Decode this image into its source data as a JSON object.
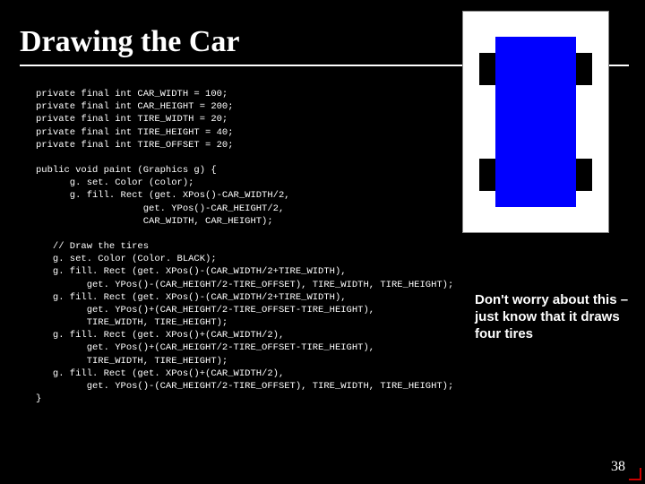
{
  "title": "Drawing the Car",
  "code": {
    "decl_1": "private final int CAR_WIDTH = 100;",
    "decl_2": "private final int CAR_HEIGHT = 200;",
    "decl_3": "private final int TIRE_WIDTH = 20;",
    "decl_4": "private final int TIRE_HEIGHT = 40;",
    "decl_5": "private final int TIRE_OFFSET = 20;",
    "paint_1": "public void paint (Graphics g) {",
    "paint_2": "      g. set. Color (color);",
    "paint_3": "      g. fill. Rect (get. XPos()-CAR_WIDTH/2,",
    "paint_4": "                   get. YPos()-CAR_HEIGHT/2,",
    "paint_5": "                   CAR_WIDTH, CAR_HEIGHT);",
    "tires_0": "   // Draw the tires",
    "tires_1": "   g. set. Color (Color. BLACK);",
    "tires_2": "   g. fill. Rect (get. XPos()-(CAR_WIDTH/2+TIRE_WIDTH),",
    "tires_3": "         get. YPos()-(CAR_HEIGHT/2-TIRE_OFFSET), TIRE_WIDTH, TIRE_HEIGHT);",
    "tires_4": "   g. fill. Rect (get. XPos()-(CAR_WIDTH/2+TIRE_WIDTH),",
    "tires_5": "         get. YPos()+(CAR_HEIGHT/2-TIRE_OFFSET-TIRE_HEIGHT),",
    "tires_6": "         TIRE_WIDTH, TIRE_HEIGHT);",
    "tires_7": "   g. fill. Rect (get. XPos()+(CAR_WIDTH/2),",
    "tires_8": "         get. YPos()+(CAR_HEIGHT/2-TIRE_OFFSET-TIRE_HEIGHT),",
    "tires_9": "         TIRE_WIDTH, TIRE_HEIGHT);",
    "tires_10": "   g. fill. Rect (get. XPos()+(CAR_WIDTH/2),",
    "tires_11": "         get. YPos()-(CAR_HEIGHT/2-TIRE_OFFSET), TIRE_WIDTH, TIRE_HEIGHT);",
    "close": "}"
  },
  "callout": "Don't worry about this – just know that it draws four tires",
  "page_number": "38"
}
